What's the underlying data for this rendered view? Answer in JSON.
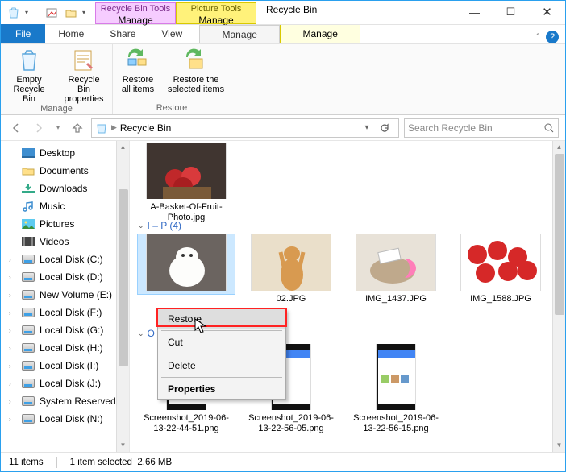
{
  "title": "Recycle Bin",
  "tool_tabs": {
    "recycle": {
      "header": "Recycle Bin Tools",
      "label": "Manage"
    },
    "picture": {
      "header": "Picture Tools",
      "label": "Manage"
    }
  },
  "menu_tabs": {
    "file": "File",
    "home": "Home",
    "share": "Share",
    "view": "View"
  },
  "ribbon": {
    "empty": "Empty Recycle Bin",
    "properties": "Recycle Bin properties",
    "restore_all": "Restore all items",
    "restore_sel": "Restore the selected items",
    "group_manage": "Manage",
    "group_restore": "Restore"
  },
  "address": {
    "location": "Recycle Bin"
  },
  "search": {
    "placeholder": "Search Recycle Bin"
  },
  "sidebar": [
    {
      "label": "Desktop",
      "kind": "desktop",
      "exp": false
    },
    {
      "label": "Documents",
      "kind": "folder",
      "exp": false
    },
    {
      "label": "Downloads",
      "kind": "download",
      "exp": false
    },
    {
      "label": "Music",
      "kind": "music",
      "exp": false
    },
    {
      "label": "Pictures",
      "kind": "pictures",
      "exp": false
    },
    {
      "label": "Videos",
      "kind": "videos",
      "exp": false
    },
    {
      "label": "Local Disk (C:)",
      "kind": "disk",
      "exp": true
    },
    {
      "label": "Local Disk (D:)",
      "kind": "disk",
      "exp": true
    },
    {
      "label": "New Volume (E:)",
      "kind": "disk",
      "exp": true
    },
    {
      "label": "Local Disk (F:)",
      "kind": "disk",
      "exp": true
    },
    {
      "label": "Local Disk (G:)",
      "kind": "disk",
      "exp": true
    },
    {
      "label": "Local Disk (H:)",
      "kind": "disk",
      "exp": true
    },
    {
      "label": "Local Disk (I:)",
      "kind": "disk",
      "exp": true
    },
    {
      "label": "Local Disk (J:)",
      "kind": "disk",
      "exp": true
    },
    {
      "label": "System Reserved",
      "kind": "disk",
      "exp": true
    },
    {
      "label": "Local Disk (N:)",
      "kind": "disk",
      "exp": true
    }
  ],
  "files": {
    "row0": [
      {
        "name": "A-Basket-Of-Fruit-Photo.jpg"
      }
    ],
    "group1": {
      "label": "I – P (4)"
    },
    "row1": [
      {
        "name": "",
        "selected": true
      },
      {
        "name": "02.JPG"
      },
      {
        "name": "IMG_1437.JPG"
      },
      {
        "name": "IMG_1588.JPG"
      }
    ],
    "group2": {
      "label": "O"
    },
    "row2": [
      {
        "name": "Screenshot_2019-06-13-22-44-51.png"
      },
      {
        "name": "Screenshot_2019-06-13-22-56-05.png"
      },
      {
        "name": "Screenshot_2019-06-13-22-56-15.png"
      }
    ]
  },
  "context_menu": {
    "restore": "Restore",
    "cut": "Cut",
    "delete": "Delete",
    "properties": "Properties"
  },
  "status": {
    "count": "11 items",
    "selection": "1 item selected",
    "size": "2.66 MB"
  }
}
